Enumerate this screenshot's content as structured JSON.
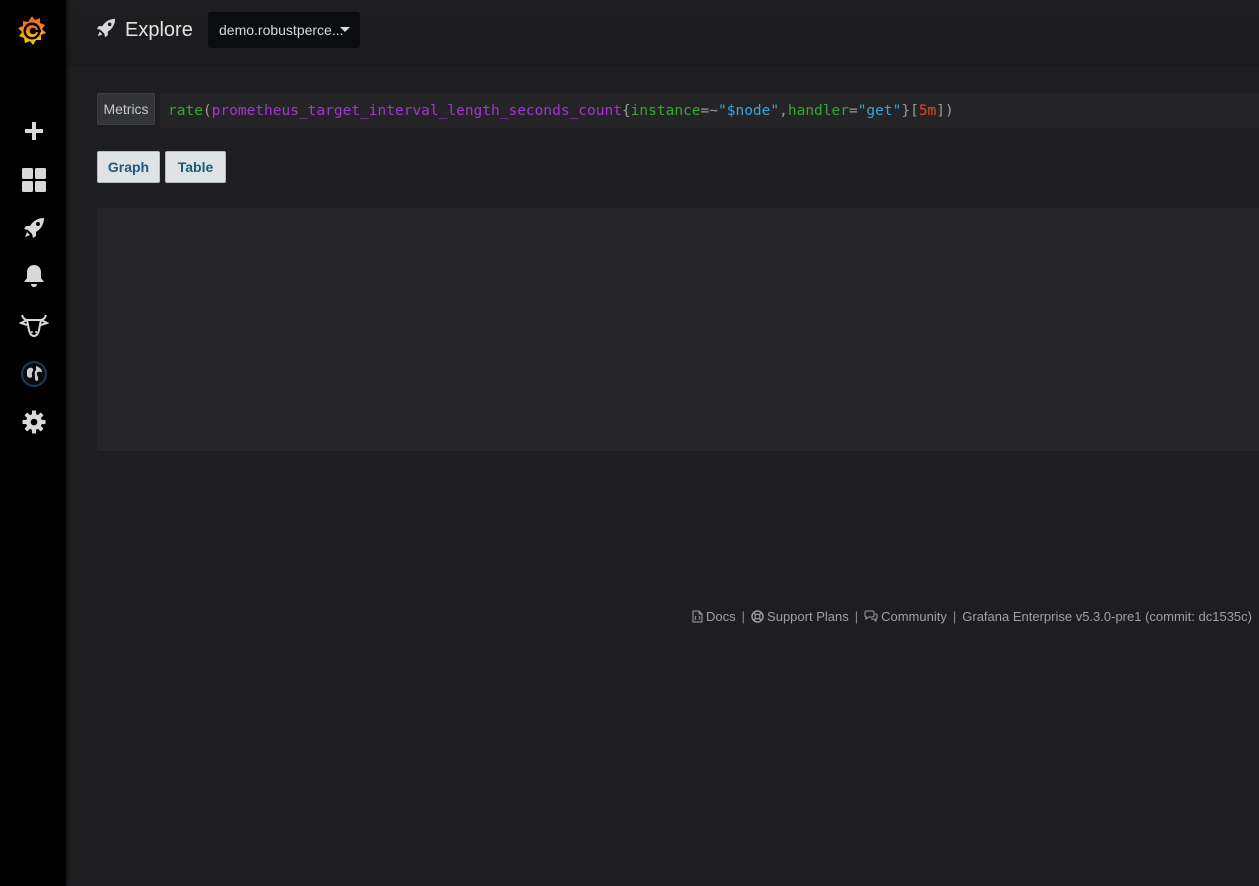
{
  "app": {
    "brand_color": "#f46800"
  },
  "sidebar": {
    "items": [
      {
        "name": "grafana-logo",
        "icon": "grafana-logo-icon"
      },
      {
        "name": "create",
        "icon": "plus-icon"
      },
      {
        "name": "dashboards",
        "icon": "grid-icon"
      },
      {
        "name": "explore",
        "icon": "rocket-icon"
      },
      {
        "name": "alerting",
        "icon": "bell-icon"
      },
      {
        "name": "plugin",
        "icon": "cow-icon"
      },
      {
        "name": "profile",
        "icon": "globe-avatar-icon"
      },
      {
        "name": "configuration",
        "icon": "gear-icon"
      }
    ]
  },
  "header": {
    "title": "Explore",
    "datasource": "demo.robustperce..."
  },
  "query": {
    "label": "Metrics",
    "tokens": {
      "fn": "rate",
      "open_paren": "(",
      "metric": "prometheus_target_interval_length_seconds_count",
      "open_brace": "{",
      "label1": "instance",
      "op1": "=~",
      "value1": "\"$node\"",
      "comma": ",",
      "label2": "handler",
      "op2": "=",
      "value2": "\"get\"",
      "close_brace": "}",
      "open_bracket": "[",
      "duration": "5m",
      "close_bracket": "]",
      "close_paren": ")"
    }
  },
  "view_buttons": {
    "graph": "Graph",
    "table": "Table"
  },
  "footer": {
    "docs": "Docs",
    "support": "Support Plans",
    "community": "Community",
    "version": "Grafana Enterprise v5.3.0-pre1 (commit: dc1535c)",
    "separator": "|"
  }
}
